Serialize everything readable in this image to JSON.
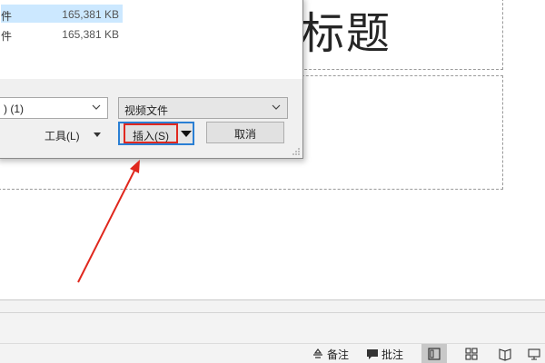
{
  "slide": {
    "title_placeholder_text": "标题"
  },
  "dialog": {
    "files": [
      {
        "name": "件",
        "size": "165,381 KB",
        "selected": true
      },
      {
        "name": "件",
        "size": "165,381 KB",
        "selected": false
      }
    ],
    "filename_value": ") (1)",
    "filetype_value": "视频文件",
    "tools_label": "工具(L)",
    "insert_label": "插入(S)",
    "cancel_label": "取消"
  },
  "status_bar": {
    "notes_label": "备注",
    "comments_label": "批注",
    "views": [
      "normal-view-icon",
      "slide-sorter-icon",
      "reading-view-icon",
      "slideshow-icon"
    ],
    "active_view": "normal-view-icon"
  },
  "annotation": {
    "highlight_color": "#e0281e",
    "focus_color": "#2a7fd4"
  }
}
